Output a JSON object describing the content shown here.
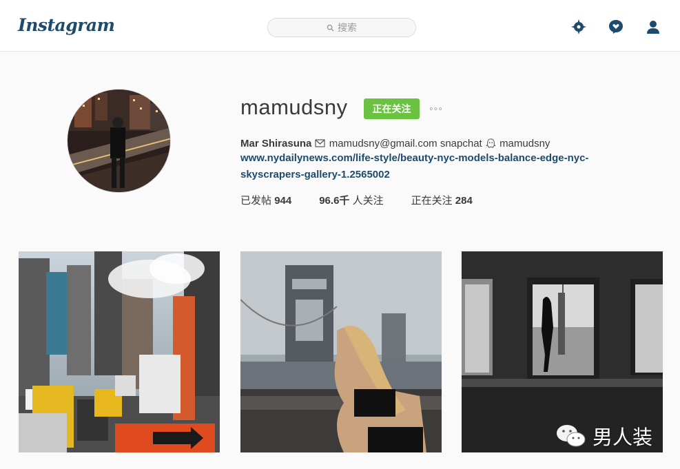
{
  "header": {
    "logo": "Instagram",
    "search_placeholder": "搜索",
    "icons": [
      "explore-icon",
      "activity-heart-icon",
      "profile-icon"
    ],
    "accent_color": "#1d4b6e"
  },
  "profile": {
    "username": "mamudsny",
    "follow_button": "正在关注",
    "more_label": "◦◦◦",
    "full_name": "Mar Shirasuna",
    "bio_email": "mamudsny@gmail.com",
    "bio_snapchat": "snapchat",
    "bio_snap_handle": "mamudsny",
    "link": "www.nydailynews.com/life-style/beauty-nyc-models-balance-edge-nyc-skyscrapers-gallery-1.2565002",
    "stats": [
      {
        "label": "已发帖",
        "value": "944"
      },
      {
        "value": "96.6千",
        "label": "人关注"
      },
      {
        "label": "正在关注",
        "value": "284"
      }
    ],
    "follow_color": "#6bc240"
  },
  "posts": [
    {
      "alt": "NYC street with taxis and steam"
    },
    {
      "alt": "Woman posing by Manhattan Bridge"
    },
    {
      "alt": "Silhouette in window with Empire State Building"
    }
  ],
  "watermark": {
    "text": "男人装"
  }
}
